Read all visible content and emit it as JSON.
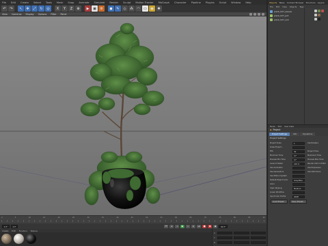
{
  "app": {
    "menu": [
      "File",
      "Edit",
      "Create",
      "Select",
      "Tools",
      "Mesh",
      "Snap",
      "Animate",
      "Simulate",
      "Render",
      "Sculpt",
      "Motion Tracker",
      "MoGraph",
      "Character",
      "Pipeline",
      "Plugins",
      "Script",
      "Window",
      "Help"
    ],
    "toolbar_icons": [
      "undo-icon",
      "redo-icon",
      "live-select-icon",
      "move-icon",
      "scale-icon",
      "rotate-icon",
      "recent-tool-icon",
      "x-axis-icon",
      "y-axis-icon",
      "z-axis-icon",
      "coordinate-system-icon",
      "render-view-icon",
      "render-picture-viewer-icon",
      "edit-render-settings-icon",
      "cube-icon",
      "pen-icon",
      "subdivision-icon",
      "array-icon",
      "deformer-icon",
      "floor-icon",
      "camera-icon",
      "light-icon"
    ],
    "view_menu": [
      "View",
      "Cameras",
      "Display",
      "Options",
      "Filter",
      "Panel"
    ]
  },
  "timeline": {
    "ruler": [
      "0",
      "5",
      "10",
      "15",
      "20",
      "25",
      "30",
      "35",
      "40",
      "45",
      "50",
      "55",
      "60",
      "65",
      "70",
      "75",
      "80",
      "85",
      "90"
    ],
    "start_field": "0 F",
    "end_field": "90 F",
    "current_field": "0 F"
  },
  "material_manager": {
    "menu": [
      "Create",
      "Edit",
      "Function",
      "Texture"
    ],
    "materials": [
      {
        "name": "mat-1",
        "color": "#7a6a58"
      },
      {
        "name": "mat-2",
        "color": "#b8b2a8"
      },
      {
        "name": "mat-3",
        "color": "#111111"
      }
    ]
  },
  "coordinates": {
    "rows": [
      "X",
      "Y",
      "Z"
    ]
  },
  "right_panel": {
    "tabs": [
      "Objects",
      "Takes",
      "Content Browser",
      "Structure",
      "Layers"
    ],
    "active_tab": "Objects",
    "om_menu": [
      "File",
      "Edit",
      "View",
      "Objects",
      "Tags",
      "Bookmarks"
    ],
    "objects": [
      {
        "name": "plant_027_leaves",
        "type": "polygon"
      },
      {
        "name": "plant_027_pot",
        "type": "null"
      },
      {
        "name": "plant_027_soil",
        "type": "null"
      }
    ],
    "attributes": {
      "menu": [
        "Mode",
        "Edit",
        "User Data"
      ],
      "title": "Project",
      "tabs": [
        "Project Settings",
        "Info",
        "Dynamics"
      ],
      "section": "Project Settings",
      "rows": [
        {
          "label": "Project Scale",
          "value": "1",
          "extra": "Centimeters"
        },
        {
          "label": "Scale Project...",
          "value": ""
        },
        {
          "label": "FPS",
          "value": "30",
          "extra": "Project Time"
        },
        {
          "label": "Minimum Time",
          "value": "0 F",
          "extra": "Maximum Time"
        },
        {
          "label": "Preview Min Time",
          "value": "0 F",
          "extra": "Preview Max Time"
        },
        {
          "label": "Level of Detail",
          "value": "100 %",
          "extra": "Render LOD in Editor"
        },
        {
          "label": "Use Animation",
          "value": "",
          "extra": "Use Expression"
        },
        {
          "label": "Use Generators",
          "value": "",
          "extra": "Use Deformers"
        },
        {
          "label": "Use Motion System",
          "value": "",
          "extra": ""
        },
        {
          "label": "Default Object Color",
          "value": "Gray-Blue"
        },
        {
          "label": "Color",
          "value": ""
        },
        {
          "label": "View Clipping",
          "value": "Medium"
        },
        {
          "label": "Linear Workflow",
          "value": ""
        },
        {
          "label": "Input Color Profile",
          "value": "sRGB"
        }
      ],
      "buttons": [
        "Load Preset...",
        "Save Preset..."
      ]
    }
  },
  "colors": {
    "viewport_bg": "#808080",
    "foliage": "#4c7a3c",
    "pot": "#0d0d0d",
    "trunk": "#5a4636"
  }
}
